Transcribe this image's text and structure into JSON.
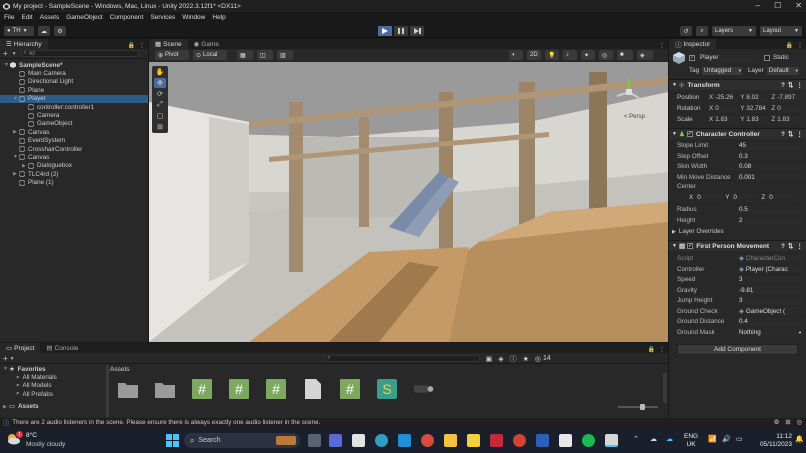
{
  "window": {
    "title": "My project - SampleScene - Windows, Mac, Linux - Unity 2022.3.12f1* <DX11>"
  },
  "menu": [
    "File",
    "Edit",
    "Assets",
    "GameObject",
    "Component",
    "Services",
    "Window",
    "Help"
  ],
  "toolbar": {
    "account": "TH",
    "layers": "Layers",
    "layout": "Layout"
  },
  "hierarchy": {
    "tab": "Hierarchy",
    "search_placeholder": "All",
    "items": [
      {
        "label": "SampleScene*",
        "depth": 0,
        "expanded": true,
        "scene": true
      },
      {
        "label": "Main Camera",
        "depth": 1
      },
      {
        "label": "Directional Light",
        "depth": 1
      },
      {
        "label": "Plane",
        "depth": 1
      },
      {
        "label": "Player",
        "depth": 1,
        "expanded": true,
        "selected": true
      },
      {
        "label": "controller:controller1",
        "depth": 2
      },
      {
        "label": "Camera",
        "depth": 2
      },
      {
        "label": "GameObject",
        "depth": 2
      },
      {
        "label": "Canvas",
        "depth": 1,
        "collapsed": true
      },
      {
        "label": "EventSystem",
        "depth": 1
      },
      {
        "label": "CrosshairController",
        "depth": 1
      },
      {
        "label": "Canvas",
        "depth": 1,
        "expanded": true
      },
      {
        "label": "Dialoguebox",
        "depth": 2,
        "collapsed": true
      },
      {
        "label": "TLC4rd (2)",
        "depth": 1,
        "collapsed": true
      },
      {
        "label": "Plane (1)",
        "depth": 1
      }
    ]
  },
  "scene": {
    "tabs": [
      "Scene",
      "Game"
    ],
    "pivot": "Pivot",
    "local": "Local",
    "mode_2d": "2D",
    "persp": "< Persp"
  },
  "inspector": {
    "tab": "Inspector",
    "object_name": "Player",
    "static_label": "Static",
    "tag_label": "Tag",
    "tag_value": "Untagged",
    "layer_label": "Layer",
    "layer_value": "Default",
    "transform": {
      "title": "Transform",
      "position": {
        "label": "Position",
        "x": "-25.26",
        "y": "8.02",
        "z": "-7.897"
      },
      "rotation": {
        "label": "Rotation",
        "x": "0",
        "y": "32.784",
        "z": "0"
      },
      "scale": {
        "label": "Scale",
        "x": "1.83",
        "y": "1.83",
        "z": "1.83"
      }
    },
    "character_controller": {
      "title": "Character Controller",
      "fields": [
        {
          "label": "Slope Limit",
          "value": "45"
        },
        {
          "label": "Step Offset",
          "value": "0.3"
        },
        {
          "label": "Skin Width",
          "value": "0.08"
        },
        {
          "label": "Min Move Distance",
          "value": "0.001"
        }
      ],
      "center_label": "Center",
      "center": {
        "x": "0",
        "y": "0",
        "z": "0"
      },
      "radius": {
        "label": "Radius",
        "value": "0.5"
      },
      "height": {
        "label": "Height",
        "value": "2"
      },
      "layer_overrides": "Layer Overrides"
    },
    "first_person_movement": {
      "title": "First Person Movement",
      "fields": [
        {
          "label": "Script",
          "value": "CharacterCon"
        },
        {
          "label": "Controller",
          "value": "Player (Charac"
        },
        {
          "label": "Speed",
          "value": "3"
        },
        {
          "label": "Gravity",
          "value": "-9.81"
        },
        {
          "label": "Jump Height",
          "value": "3"
        },
        {
          "label": "Ground Check",
          "value": "GameObject ("
        },
        {
          "label": "Ground Distance",
          "value": "0.4"
        },
        {
          "label": "Ground Mask",
          "value": "Nothing"
        }
      ]
    },
    "add_component": "Add Component"
  },
  "project": {
    "tabs": [
      "Project",
      "Console"
    ],
    "favorites": "Favorites",
    "fav_items": [
      "All Materials",
      "All Models",
      "All Prefabs"
    ],
    "assets_root": "Assets",
    "assets_header": "Assets",
    "count_badge": "14",
    "asset_types": [
      "folder",
      "folder",
      "script",
      "script",
      "script",
      "file",
      "script",
      "shader",
      "material"
    ]
  },
  "status": {
    "message": "There are 2 audio listeners in the scene. Please ensure there is always exactly one audio listener in the scene."
  },
  "taskbar": {
    "weather_temp": "8°C",
    "weather_desc": "Mostly cloudy",
    "weather_badge": "1",
    "search": "Search",
    "lang_top": "ENG",
    "lang_bottom": "UK",
    "time": "11:12",
    "date": "05/11/2023"
  }
}
